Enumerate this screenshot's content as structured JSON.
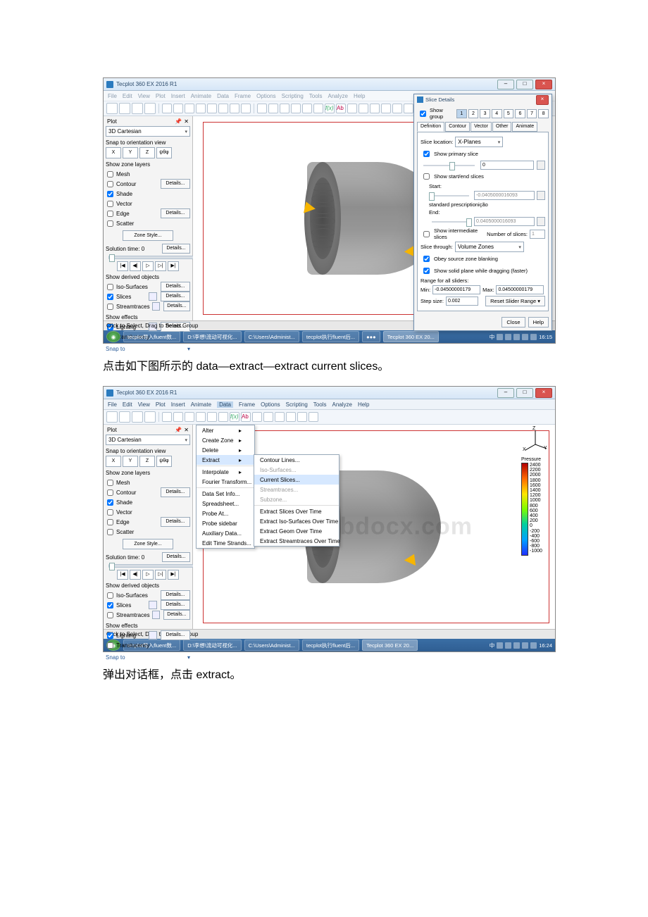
{
  "captions": {
    "c1": "点击如下图所示的 data—extract—extract current slices。",
    "c2": "弹出对话框，点击 extract。"
  },
  "app": {
    "title": "Tecplot 360 EX 2016 R1",
    "menus": [
      "File",
      "Edit",
      "View",
      "Plot",
      "Insert",
      "Animate",
      "Data",
      "Frame",
      "Options",
      "Scripting",
      "Tools",
      "Analyze",
      "Help"
    ],
    "statusbar": "Click to Select, Drag to Select Group"
  },
  "plot_panel": {
    "header": "Plot",
    "close": "✕",
    "type": "3D Cartesian",
    "snap_title": "Snap to orientation view",
    "orient": [
      "X",
      "Y",
      "Z",
      "ψθφ"
    ],
    "layers_title": "Show zone layers",
    "layers": [
      {
        "label": "Mesh",
        "checked": false,
        "details": false
      },
      {
        "label": "Contour",
        "checked": false,
        "details": true
      },
      {
        "label": "Shade",
        "checked": true,
        "details": false
      },
      {
        "label": "Vector",
        "checked": false,
        "details": false
      },
      {
        "label": "Edge",
        "checked": false,
        "details": true
      },
      {
        "label": "Scatter",
        "checked": false,
        "details": false
      }
    ],
    "zone_style": "Zone Style...",
    "solution_time_label": "Solution time: 0",
    "details": "Details...",
    "play": [
      "|◀",
      "◀|",
      "▷",
      "▷|",
      "▶|"
    ],
    "derived_title": "Show derived objects",
    "derived": [
      {
        "label": "Iso-Surfaces",
        "checked": false,
        "details": true
      },
      {
        "label": "Slices",
        "checked": true,
        "details": true,
        "icon": true
      },
      {
        "label": "Streamtraces",
        "checked": false,
        "details": true,
        "icon": true
      }
    ],
    "effects_title": "Show effects",
    "effects": [
      {
        "label": "Lighting",
        "checked": true,
        "details": true,
        "icon": true
      },
      {
        "label": "Translucency",
        "checked": false,
        "details": false
      }
    ],
    "snap_to": "Snap to"
  },
  "axis_labels": {
    "x": "X",
    "y": "Y",
    "z": "Z"
  },
  "legend": {
    "title": "Pressure",
    "vals": [
      "2400",
      "2200",
      "2000",
      "1800",
      "1600",
      "1400",
      "1200",
      "1000",
      "800",
      "600",
      "400",
      "200",
      "0",
      "-200",
      "-400",
      "-600",
      "-800",
      "-1000"
    ]
  },
  "data_menu": {
    "items": [
      "Alter",
      "Create Zone",
      "Delete",
      "Extract",
      "Interpolate",
      "Fourier Transform...",
      "Data Set Info...",
      "Spreadsheet...",
      "Probe At...",
      "Probe sidebar",
      "Auxiliary Data...",
      "Edit Time Strands..."
    ],
    "arrow": "▸",
    "extract_sub": [
      "Contour Lines...",
      "Iso-Surfaces...",
      "Current Slices...",
      "Streamtraces...",
      "Subzone...",
      "Extract Slices Over Time",
      "Extract Iso-Surfaces Over Time",
      "Extract Geom Over Time",
      "Extract Streamtraces Over Time"
    ]
  },
  "slice_dialog": {
    "title": "Slice Details",
    "show_group": "Show group",
    "groups": [
      "1",
      "2",
      "3",
      "4",
      "5",
      "6",
      "7",
      "8"
    ],
    "tabs": [
      "Definition",
      "Contour",
      "Vector",
      "Other",
      "Animate"
    ],
    "slice_loc_label": "Slice location:",
    "slice_loc_value": "X-Planes",
    "show_primary": "Show primary slice",
    "primary_val": "0",
    "show_start_end": "Show start/end slices",
    "start": "Start:",
    "start_val": "-0.0405000016093",
    "end": "End:",
    "end_val": "0.0405000016093",
    "show_intermediate": "Show intermediate slices",
    "num_slices_label": "Number of slices:",
    "num_slices_val": "1",
    "slice_through_label": "Slice through:",
    "slice_through_val": "Volume Zones",
    "obey": "Obey source zone blanking",
    "solid": "Show solid plane while dragging (faster)",
    "range_label": "Range for all sliders:",
    "min_label": "Min:",
    "min_val": "-0.04500000179",
    "max_label": "Max:",
    "0.04500000179": "0.04500000179",
    "max_val": "0.04500000179",
    "step_label": "Step size:",
    "step_val": "0.002",
    "reset": "Reset Slider Range ▾",
    "close": "Close",
    "help": "Help"
  },
  "taskbar": {
    "items1": [
      "tecplot导入fluent数...",
      "D:\\李想\\流动可视化...",
      "C:\\Users\\Administ...",
      "tecplot执行fluent后...",
      "●●●"
    ],
    "active1": "Tecplot 360 EX 20...",
    "items2": [
      "tecplot导入fluent数...",
      "D:\\李想\\流动可视化...",
      "C:\\Users\\Administ...",
      "tecplot执行fluent后..."
    ],
    "active2": "Tecplot 360 EX 20...",
    "time1": "16:15",
    "time2": "16:24",
    "ime": "中"
  },
  "watermark": "www.bdocx.com"
}
